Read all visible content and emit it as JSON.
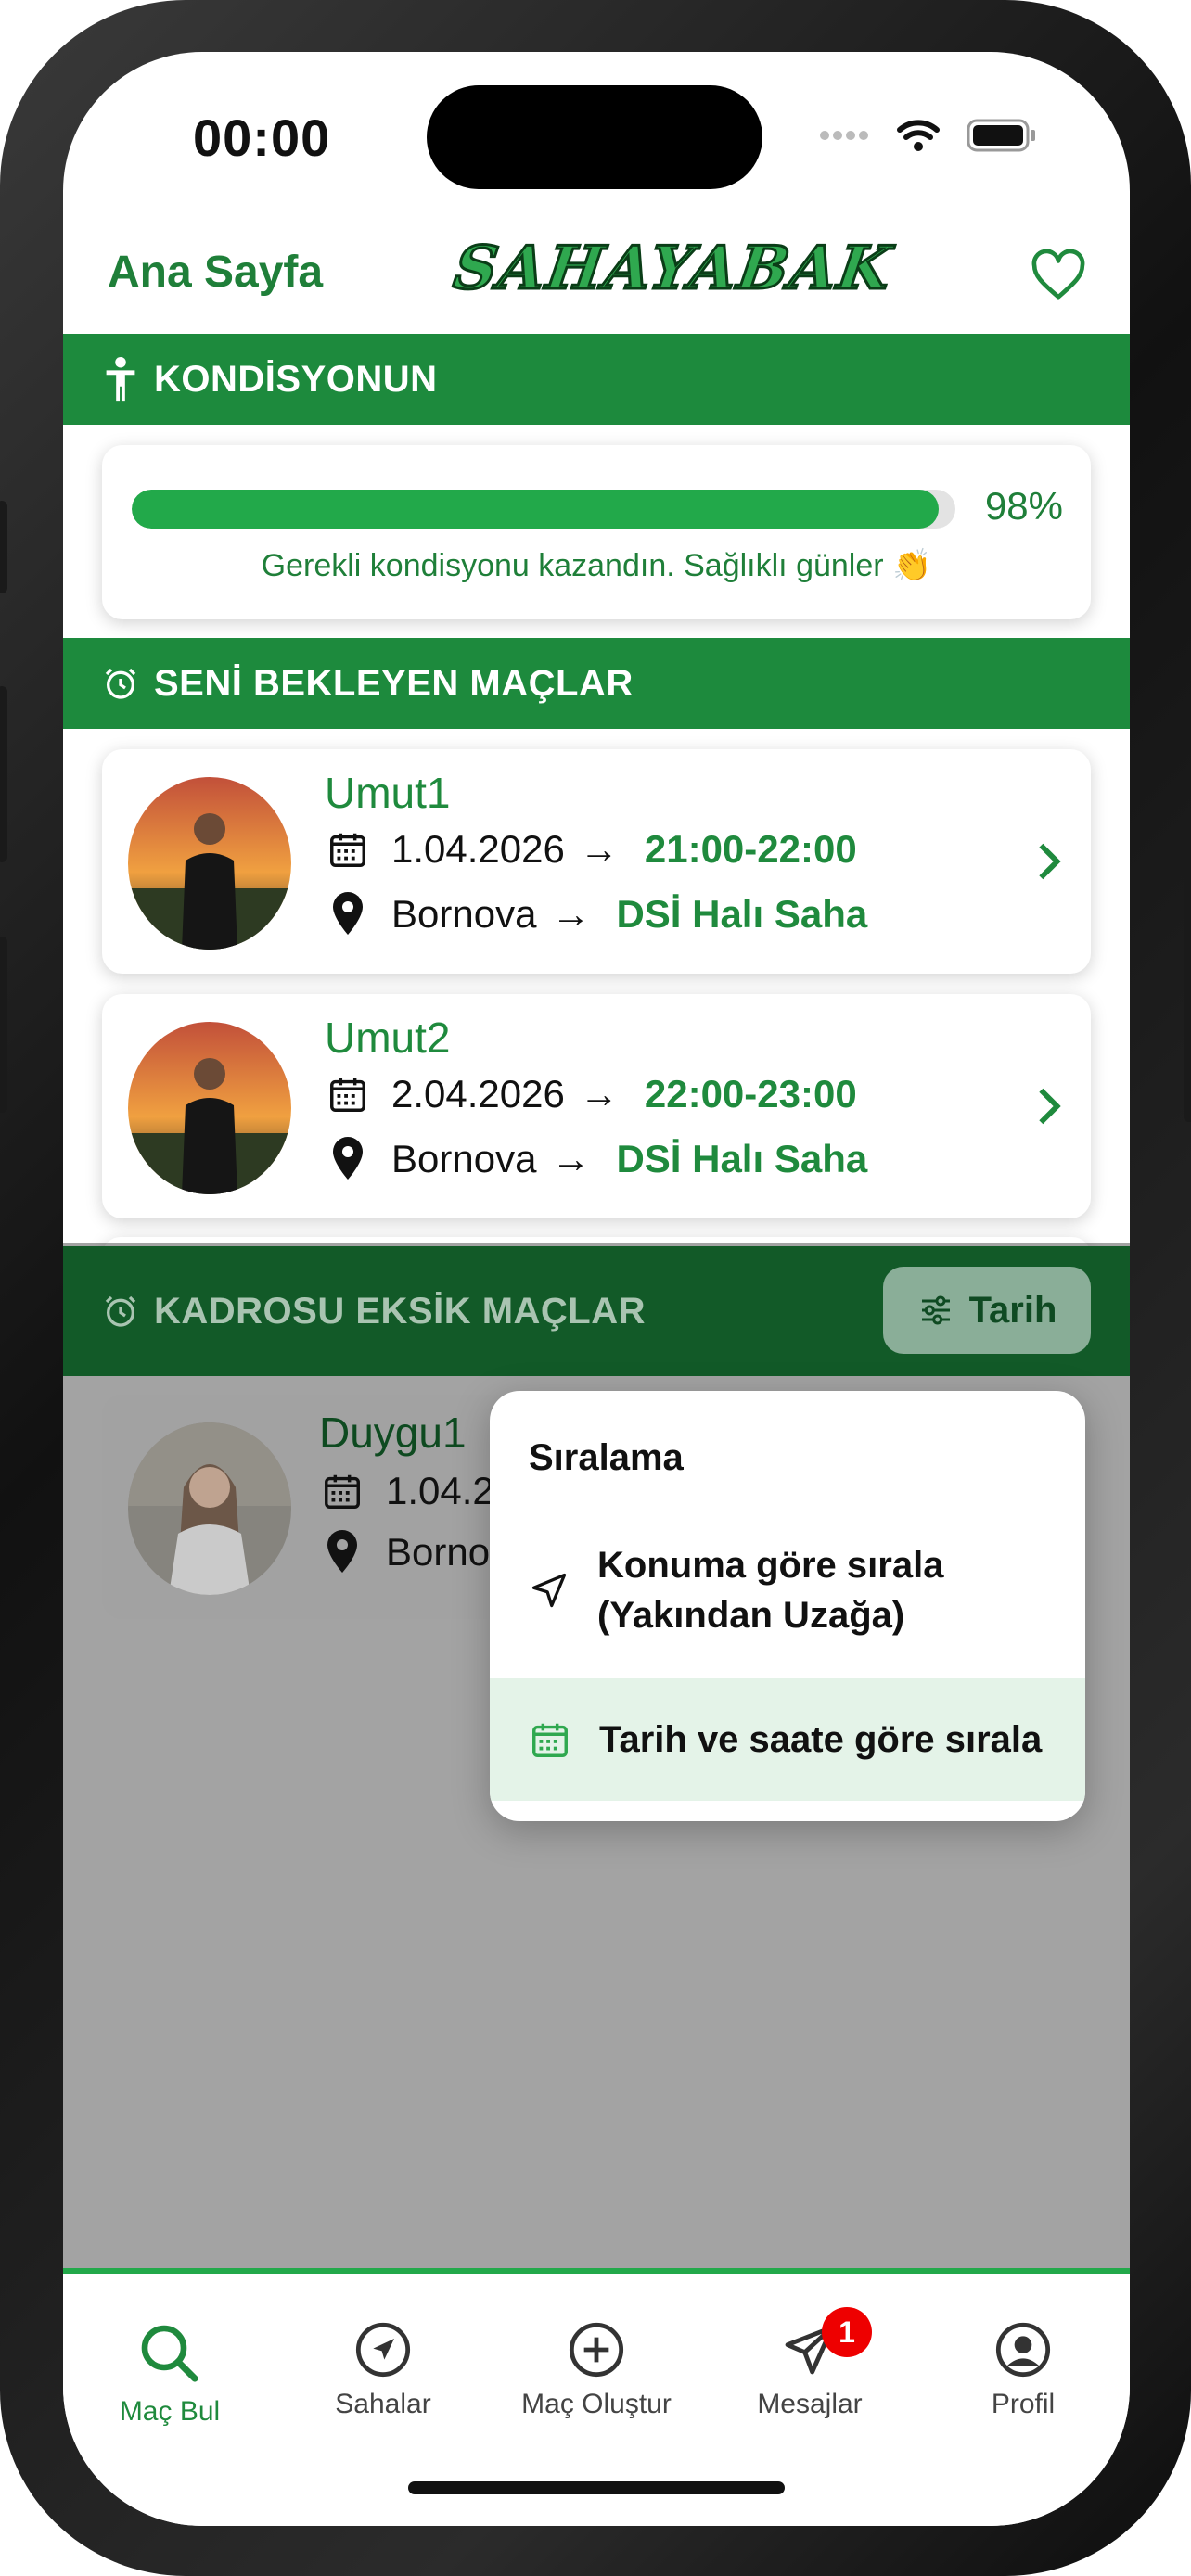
{
  "status_bar": {
    "time": "00:00"
  },
  "header": {
    "title": "Ana Sayfa",
    "brand": "SAHAYABAK"
  },
  "fitness": {
    "section_title": "KONDİSYONUN",
    "progress_fraction": 0.98,
    "percent_label": "98%",
    "message": "Gerekli kondisyonu kazandın. Sağlıklı günler 👏"
  },
  "waiting_matches": {
    "section_title": "SENİ BEKLEYEN MAÇLAR",
    "items": [
      {
        "name": "Umut1",
        "date": "1.04.2026",
        "time": "21:00-22:00",
        "district": "Bornova",
        "venue": "DSİ Halı Saha"
      },
      {
        "name": "Umut2",
        "date": "2.04.2026",
        "time": "22:00-23:00",
        "district": "Bornova",
        "venue": "DSİ Halı Saha"
      }
    ]
  },
  "missing_squad": {
    "section_title": "KADROSU EKSİK MAÇLAR",
    "filter_label": "Tarih",
    "items": [
      {
        "name": "Duygu1",
        "date": "1.04.2",
        "district": "Borno"
      }
    ]
  },
  "sort_menu": {
    "title": "Sıralama",
    "options": [
      {
        "line1": "Konuma göre sırala",
        "line2": "(Yakından Uzağa)"
      },
      {
        "line1": "Tarih ve saate göre sırala"
      }
    ],
    "selected_index": 1
  },
  "tabbar": {
    "tabs": [
      {
        "label": "Maç Bul",
        "icon": "search-icon"
      },
      {
        "label": "Sahalar",
        "icon": "compass-icon"
      },
      {
        "label": "Maç Oluştur",
        "icon": "plus-circle-icon"
      },
      {
        "label": "Mesajlar",
        "icon": "paper-plane-icon"
      },
      {
        "label": "Profil",
        "icon": "profile-icon"
      }
    ],
    "messages_badge": "1",
    "active_index": 0
  },
  "colors": {
    "brand_green": "#1d8a3d",
    "accent_green": "#22a94a",
    "badge_red": "#e00000"
  }
}
